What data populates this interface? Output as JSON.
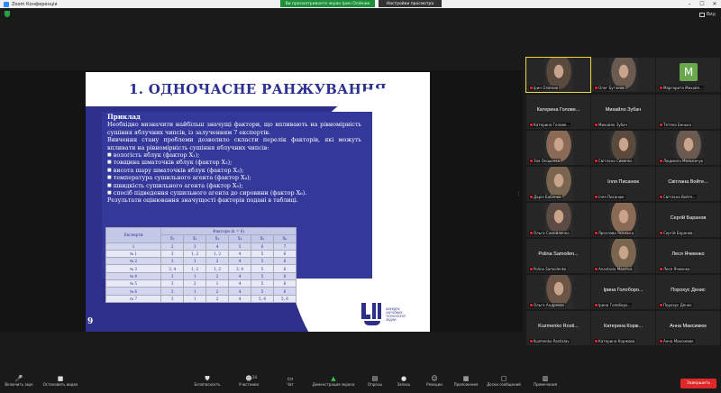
{
  "window": {
    "title": "Zoom Конференція"
  },
  "share_banner": "Ви просматриваете экран Ірин Олійник",
  "view_options": "Настройки просмотра",
  "view_label": "Вид",
  "slide": {
    "title": "1. ОДНОЧАСНЕ РАНЖУВАННЯ",
    "heading": "Приклад",
    "paragraphs": [
      "Необхідно визначити найбільш значущі фактори, що впливають на рівномірність сушіння яблучних чипсів, із залученням 7 експертів.",
      "Вивчення стану проблеми дозволило скласти перелік факторів, які можуть впливати на рівномірність сушіння яблучних чипсів:"
    ],
    "bullets": [
      "вологість яблук (фактор X₁);",
      "товщина шматочків яблук (фактор X₂);",
      "висота шару шматочків яблук (фактор X₃);",
      "температура сушильного агента (фактор X₄);",
      "швидкість сушильного агента (фактор X₅);",
      "спосіб підведення сушильного агента до сировини (фактор X₆)."
    ],
    "result": "Результати оцінювання значущості факторів подані в таблиці.",
    "table": {
      "col_expert": "Експерти",
      "col_factors": "Фактори (k = 6)",
      "factor_headers": [
        "X₁",
        "X₂",
        "X₃",
        "X₄",
        "X₅",
        "X₆"
      ],
      "index_row": [
        "1",
        "2",
        "3",
        "4",
        "5",
        "6",
        "7"
      ],
      "rows": [
        [
          "№ 1",
          "3",
          "1, 2",
          "1, 2",
          "4",
          "5",
          "6"
        ],
        [
          "№ 2",
          "3",
          "1",
          "2",
          "4",
          "5",
          "6"
        ],
        [
          "№ 3",
          "3, 4",
          "1, 2",
          "1, 2",
          "3, 4",
          "5",
          "6"
        ],
        [
          "№ 4",
          "3",
          "1",
          "2",
          "4",
          "5",
          "6"
        ],
        [
          "№ 5",
          "3",
          "2",
          "1",
          "4",
          "5",
          "6"
        ],
        [
          "№ 6",
          "3",
          "1",
          "2",
          "4",
          "5",
          "6"
        ],
        [
          "№ 7",
          "3",
          "1",
          "2",
          "4",
          "5, 6",
          "5, 6"
        ]
      ]
    },
    "page_number": "9",
    "logo_text": [
      "КАФЕДРА",
      "ХАРЧОВИХ",
      "ТЕХНОЛОГІЙ",
      "ЗЕДНИ"
    ]
  },
  "participants": [
    {
      "name": "",
      "label": "Ірин Олійник",
      "kind": "video",
      "active": true
    },
    {
      "name": "",
      "label": "Олег Бутаков",
      "kind": "video"
    },
    {
      "name": "M",
      "label": "Маргарита Михайл...",
      "kind": "avatar"
    },
    {
      "name": "Катерина Голове...",
      "label": "Катерина Голове...",
      "kind": "name"
    },
    {
      "name": "Михайло Зубач",
      "label": "Михайло Зубач",
      "kind": "name"
    },
    {
      "name": "",
      "label": "Тетяна Бенько",
      "kind": "name"
    },
    {
      "name": "",
      "label": "Зоя Оніщенко",
      "kind": "video"
    },
    {
      "name": "",
      "label": "Світлана Сивенко",
      "kind": "video"
    },
    {
      "name": "",
      "label": "Людмила Мельничук",
      "kind": "video"
    },
    {
      "name": "",
      "label": "Дарія Бабенко",
      "kind": "video"
    },
    {
      "name": "Ілля Писанюк",
      "label": "Ілля Писанюк",
      "kind": "name"
    },
    {
      "name": "Світлана Войте...",
      "label": "Світлана Войте...",
      "kind": "name"
    },
    {
      "name": "",
      "label": "Ольга Самойленко",
      "kind": "video"
    },
    {
      "name": "",
      "label": "Ярослава Ясінська",
      "kind": "video"
    },
    {
      "name": "Сергій Баранов",
      "label": "Сергій Баранов",
      "kind": "name"
    },
    {
      "name": "Polina Samoilen...",
      "label": "Polina Samoilenko",
      "kind": "name"
    },
    {
      "name": "",
      "label": "Anastasia Marchuk",
      "kind": "video"
    },
    {
      "name": "Леся Ячменко",
      "label": "Леся Ячменко",
      "kind": "name"
    },
    {
      "name": "",
      "label": "Ольга Андреєва",
      "kind": "video"
    },
    {
      "name": "Ірина Голоборо...",
      "label": "Ірина Голоборо...",
      "kind": "name"
    },
    {
      "name": "Порохус Денис",
      "label": "Порохус Денис",
      "kind": "name"
    },
    {
      "name": "Kuzmenko Rosti...",
      "label": "Kuzmenko Rostislav",
      "kind": "name"
    },
    {
      "name": "Катерина Корж...",
      "label": "Катерина Коржова",
      "kind": "name"
    },
    {
      "name": "Анна Максимюк",
      "label": "Анна Максимюк",
      "kind": "name"
    }
  ],
  "toolbar": {
    "items": [
      {
        "id": "mic",
        "label": "Включить звук",
        "icon": "mic-muted-icon"
      },
      {
        "id": "video",
        "label": "Остановить видео",
        "icon": "camera-icon"
      },
      {
        "id": "security",
        "label": "Безопасность",
        "icon": "shield-icon"
      },
      {
        "id": "participants",
        "label": "Участники",
        "icon": "participants-icon",
        "count": "24"
      },
      {
        "id": "chat",
        "label": "Чат",
        "icon": "chat-icon"
      },
      {
        "id": "share",
        "label": "Демонстрация экрана",
        "icon": "share-screen-icon"
      },
      {
        "id": "polls",
        "label": "Опросы",
        "icon": "poll-icon"
      },
      {
        "id": "record",
        "label": "Запись",
        "icon": "record-icon"
      },
      {
        "id": "reactions",
        "label": "Реакции",
        "icon": "reaction-icon"
      },
      {
        "id": "apps",
        "label": "Приложения",
        "icon": "apps-icon"
      },
      {
        "id": "whiteboards",
        "label": "Доски сообщений",
        "icon": "whiteboard-icon"
      },
      {
        "id": "notes",
        "label": "Примечания",
        "icon": "notes-icon"
      }
    ],
    "end_label": "Завершить"
  }
}
